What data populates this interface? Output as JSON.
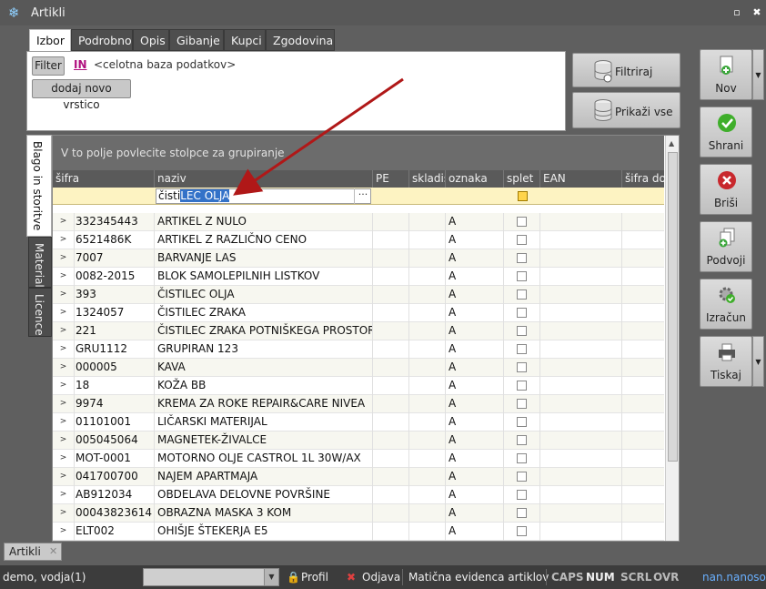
{
  "window": {
    "title": "Artikli",
    "restore_label": "▫",
    "close_label": "✖"
  },
  "tabs": [
    "Izbor",
    "Podrobno",
    "Opis",
    "Gibanje",
    "Kupci",
    "Zgodovina"
  ],
  "filter": {
    "filter_button": "Filter",
    "operator": "IN",
    "value": "<celotna baza podatkov>",
    "add_row_button": "dodaj novo vrstico",
    "apply_button": "Filtriraj",
    "show_all_button": "Prikaži vse"
  },
  "side_tabs": [
    "Blago in storitve",
    "Material",
    "Licence"
  ],
  "grid": {
    "group_hint": "V to polje povlecite stolpce za grupiranje",
    "columns": [
      "šifra",
      "naziv",
      "PE",
      "skladiš",
      "oznaka",
      "splet",
      "EAN",
      "šifra dob"
    ],
    "filter_input": {
      "prefix": "čisti",
      "selected": "LEC OLJA",
      "ellipsis": "···"
    },
    "rows": [
      {
        "code": "332345443",
        "name": "ARTIKEL Z NULO",
        "mark": "A"
      },
      {
        "code": "6521486K",
        "name": "ARTIKEL Z RAZLIČNO CENO",
        "mark": "A"
      },
      {
        "code": "7007",
        "name": "BARVANJE LAS",
        "mark": "A"
      },
      {
        "code": "0082-2015",
        "name": "BLOK SAMOLEPILNIH LISTKOV",
        "mark": "A"
      },
      {
        "code": "393",
        "name": "ČISTILEC OLJA",
        "mark": "A"
      },
      {
        "code": "1324057",
        "name": "ČISTILEC ZRAKA",
        "mark": "A"
      },
      {
        "code": "221",
        "name": "ČISTILEC ZRAKA POTNIŠKEGA PROSTORA",
        "mark": "A"
      },
      {
        "code": "GRU1112",
        "name": "GRUPIRAN 123",
        "mark": "A"
      },
      {
        "code": "000005",
        "name": "KAVA",
        "mark": "A"
      },
      {
        "code": "18",
        "name": "KOŽA BB",
        "mark": "A"
      },
      {
        "code": "9974",
        "name": "KREMA ZA ROKE REPAIR&CARE NIVEA",
        "mark": "A"
      },
      {
        "code": "01101001",
        "name": "LIČARSKI MATERIJAL",
        "mark": "A"
      },
      {
        "code": "005045064",
        "name": "MAGNETEK-ŽIVALCE",
        "mark": "A"
      },
      {
        "code": "MOT-0001",
        "name": "MOTORNO OLJE CASTROL 1L 30W/AX",
        "mark": "A"
      },
      {
        "code": "041700700",
        "name": "NAJEM APARTMAJA",
        "mark": "A"
      },
      {
        "code": "AB912034",
        "name": "OBDELAVA DELOVNE POVRŠINE",
        "mark": "A"
      },
      {
        "code": "00043823614",
        "name": "OBRAZNA MASKA 3 KOM",
        "mark": "A"
      },
      {
        "code": "ELT002",
        "name": "OHIŠJE ŠTEKERJA E5",
        "mark": "A"
      }
    ]
  },
  "actions": [
    "Nov",
    "Shrani",
    "Briši",
    "Podvoji",
    "Izračun",
    "Tiskaj"
  ],
  "doc_tab": {
    "label": "Artikli",
    "close": "✕"
  },
  "status": {
    "user": "demo, vodja(1)",
    "profile": "Profil",
    "logout": "Odjava",
    "module": "Matična evidenca artiklov",
    "caps": "CAPS",
    "num": "NUM",
    "scrl": "SCRL",
    "ovr": "OVR",
    "brand": "nan.nanosoft"
  },
  "colors": {
    "accent_red": "#b01818",
    "selection": "#3372c8",
    "filter_row": "#fdf3c2"
  }
}
